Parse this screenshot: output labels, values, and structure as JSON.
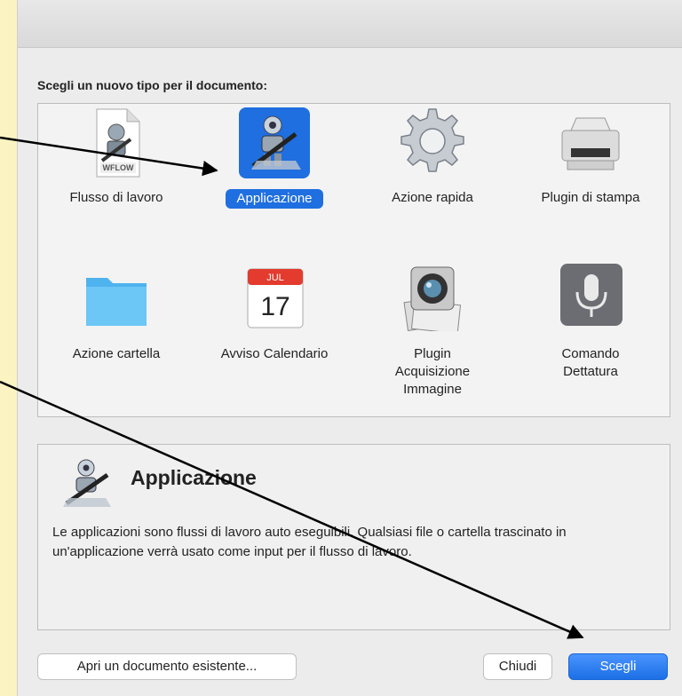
{
  "dialog": {
    "heading": "Scegli un nuovo tipo per il documento:",
    "types": [
      {
        "label": "Flusso di lavoro",
        "icon": "workflow-file-icon",
        "badge": "WFLOW",
        "selected": false
      },
      {
        "label": "Applicazione",
        "icon": "automator-robot-icon",
        "selected": true
      },
      {
        "label": "Azione rapida",
        "icon": "gear-icon",
        "selected": false
      },
      {
        "label": "Plugin di stampa",
        "icon": "printer-icon",
        "selected": false
      },
      {
        "label": "Azione cartella",
        "icon": "folder-icon",
        "selected": false
      },
      {
        "label": "Avviso Calendario",
        "icon": "calendar-icon",
        "month": "JUL",
        "day": "17",
        "selected": false
      },
      {
        "label": "Plugin Acquisizione Immagine",
        "label_lines": [
          "Plugin",
          "Acquisizione",
          "Immagine"
        ],
        "icon": "image-capture-icon",
        "selected": false
      },
      {
        "label": "Comando Dettatura",
        "label_lines": [
          "Comando",
          "Dettatura"
        ],
        "icon": "microphone-icon",
        "selected": false
      }
    ],
    "detail": {
      "title": "Applicazione",
      "description": "Le applicazioni sono flussi di lavoro auto eseguibili. Qualsiasi file o cartella trascinato in un'applicazione verrà usato come input per il flusso di lavoro."
    },
    "buttons": {
      "open_existing": "Apri un documento esistente...",
      "close": "Chiudi",
      "choose": "Scegli"
    }
  },
  "colors": {
    "accent": "#1f6fe0",
    "background": "#fbf4c2",
    "annotation": "#000000"
  }
}
